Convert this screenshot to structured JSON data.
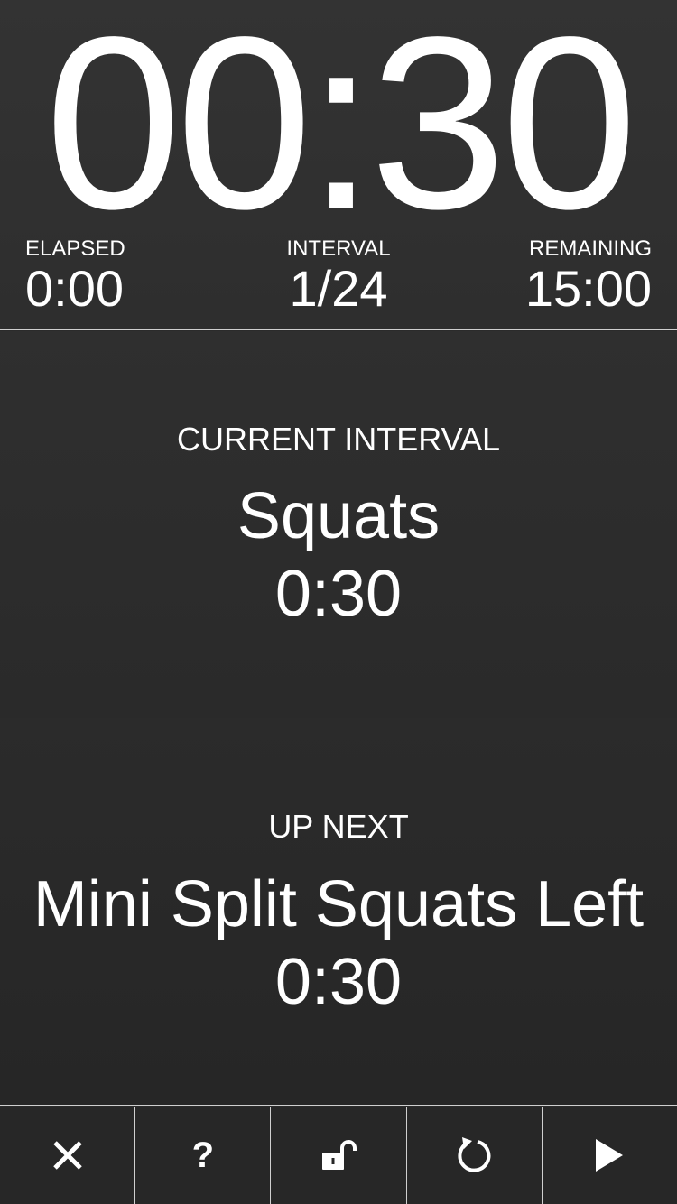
{
  "timer": {
    "clock": "00:30",
    "elapsed_label": "ELAPSED",
    "elapsed_value": "0:00",
    "interval_label": "INTERVAL",
    "interval_value": "1/24",
    "remaining_label": "REMAINING",
    "remaining_value": "15:00"
  },
  "current": {
    "label": "CURRENT INTERVAL",
    "name": "Squats",
    "time": "0:30"
  },
  "next": {
    "label": "UP NEXT",
    "name": "Mini Split Squats Left",
    "time": "0:30"
  },
  "toolbar": {
    "help_glyph": "?",
    "icons": [
      "close-icon",
      "help-icon",
      "unlock-icon",
      "restart-icon",
      "play-icon"
    ]
  },
  "colors": {
    "text": "#ffffff",
    "background": "#2b2b2b",
    "divider": "#cfcfcf"
  }
}
